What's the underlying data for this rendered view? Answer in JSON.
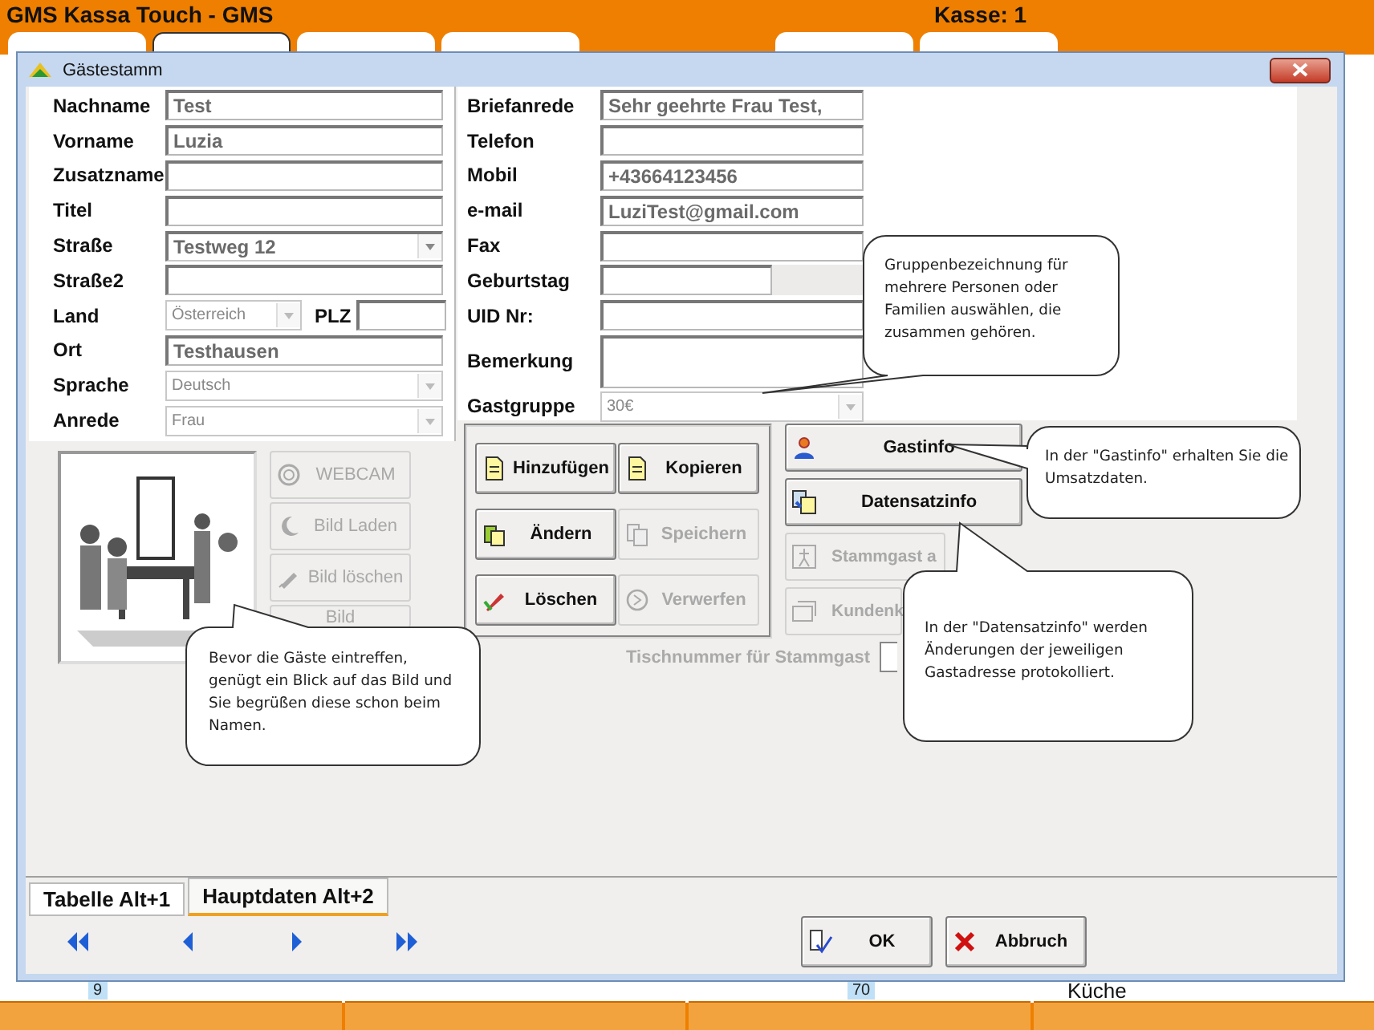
{
  "app": {
    "title": "GMS Kassa Touch - GMS",
    "register": "Kasse: 1",
    "tabs": [
      {
        "selected": false
      },
      {
        "selected": true
      },
      {
        "selected": false
      },
      {
        "selected": false
      },
      {
        "selected": false
      },
      {
        "selected": false
      }
    ]
  },
  "background": {
    "labels": [
      "9",
      "70",
      "Küche"
    ]
  },
  "dialog": {
    "title": "Gästestamm",
    "left_fields": [
      {
        "label": "Nachname",
        "kind": "text",
        "value": "Test"
      },
      {
        "label": "Vorname",
        "kind": "text",
        "value": "Luzia"
      },
      {
        "label": "Zusatzname",
        "kind": "text"
      },
      {
        "label": "Titel",
        "kind": "text"
      },
      {
        "label": "Straße",
        "kind": "combo",
        "value": "Testweg 12",
        "disabled": false
      },
      {
        "label": "Straße2",
        "kind": "text"
      },
      {
        "label": "Land",
        "kind": "combo",
        "value": "Österreich",
        "disabled": true,
        "extra_label": "PLZ"
      },
      {
        "label": "Ort",
        "kind": "text",
        "value": "Testhausen"
      },
      {
        "label": "Sprache",
        "kind": "combo",
        "value": "Deutsch",
        "disabled": true
      },
      {
        "label": "Anrede",
        "kind": "combo",
        "value": "Frau",
        "disabled": true
      }
    ],
    "right_fields": [
      {
        "label": "Briefanrede",
        "kind": "text",
        "value": "Sehr geehrte Frau Test,"
      },
      {
        "label": "Telefon",
        "kind": "text"
      },
      {
        "label": "Mobil",
        "kind": "text",
        "value": "+43664123456"
      },
      {
        "label": "e-mail",
        "kind": "text",
        "value": "LuziTest@gmail.com"
      },
      {
        "label": "Fax",
        "kind": "text"
      },
      {
        "label": "Geburtstag",
        "kind": "date"
      },
      {
        "label": "UID Nr:",
        "kind": "text"
      },
      {
        "label": "Bemerkung",
        "kind": "memo"
      },
      {
        "label": "Gastgruppe",
        "kind": "combo",
        "value": "30€",
        "disabled": true
      }
    ],
    "photo_buttons": [
      {
        "label": "WEBCAM",
        "disabled": true
      },
      {
        "label": "Bild Laden",
        "disabled": true
      },
      {
        "label": "Bild löschen",
        "disabled": true
      },
      {
        "label": "Bild",
        "disabled": true
      }
    ],
    "record_buttons": [
      {
        "label": "Hinzufügen",
        "disabled": false
      },
      {
        "label": "Kopieren",
        "disabled": false
      },
      {
        "label": "Ändern",
        "disabled": false
      },
      {
        "label": "Speichern",
        "disabled": true
      },
      {
        "label": "Löschen",
        "disabled": false
      },
      {
        "label": "Verwerfen",
        "disabled": true
      }
    ],
    "info_buttons": [
      {
        "label": "Gastinfo",
        "disabled": false
      },
      {
        "label": "Datensatzinfo",
        "disabled": false
      },
      {
        "label": "Stammgast a",
        "disabled": true
      },
      {
        "label": "Kundenk",
        "disabled": true
      }
    ],
    "table_number": {
      "label": "Tischnummer für Stammgast",
      "disabled": true
    },
    "tabs": [
      {
        "label": "Tabelle Alt+1",
        "selected": false
      },
      {
        "label": "Hauptdaten Alt+2",
        "selected": true
      }
    ],
    "actions": [
      {
        "label": "OK"
      },
      {
        "label": "Abbruch"
      }
    ]
  },
  "callouts": [
    {
      "text": "Gruppenbezeichnung für mehrere Personen oder Familien auswählen, die zusammen gehören."
    },
    {
      "text": "In der \"Gastinfo\" erhalten Sie die Umsatzdaten."
    },
    {
      "text": "In der \"Datensatzinfo\" werden Änderungen der jeweiligen Gastadresse protokolliert."
    },
    {
      "text": "Bevor die Gäste eintreffen, genügt ein Blick auf das Bild und Sie begrüßen diese schon beim Namen."
    }
  ]
}
